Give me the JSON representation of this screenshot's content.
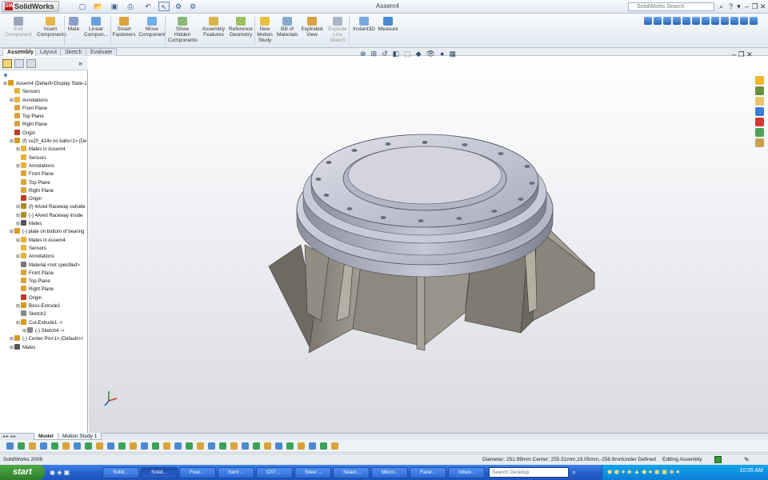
{
  "app": {
    "brand": "SolidWorks",
    "document_title": "Assem4",
    "search_placeholder": "SolidWorks Search"
  },
  "ribbon": [
    {
      "label": "Edit Component",
      "icon": "edit-component-icon",
      "enabled": false
    },
    {
      "label": "Insert Components",
      "icon": "insert-components-icon",
      "enabled": true
    },
    {
      "label": "Mate",
      "icon": "mate-icon",
      "enabled": true
    },
    {
      "label": "Linear Compon...",
      "icon": "linear-pattern-icon",
      "enabled": true
    },
    {
      "label": "Smart Fasteners",
      "icon": "smart-fasteners-icon",
      "enabled": true
    },
    {
      "label": "Move Component",
      "icon": "move-component-icon",
      "enabled": true
    },
    {
      "label": "Show Hidden Components",
      "icon": "show-hidden-icon",
      "enabled": true
    },
    {
      "label": "Assembly Features",
      "icon": "assembly-features-icon",
      "enabled": true
    },
    {
      "label": "Reference Geometry",
      "icon": "reference-geometry-icon",
      "enabled": true
    },
    {
      "label": "New Motion Study",
      "icon": "motion-study-icon",
      "enabled": true
    },
    {
      "label": "Bill of Materials",
      "icon": "bom-icon",
      "enabled": true
    },
    {
      "label": "Exploded View",
      "icon": "exploded-view-icon",
      "enabled": true
    },
    {
      "label": "Explode Line Sketch",
      "icon": "explode-line-icon",
      "enabled": false
    },
    {
      "label": "Instant3D",
      "icon": "instant3d-icon",
      "enabled": true
    },
    {
      "label": "Measure",
      "icon": "measure-icon",
      "enabled": true
    }
  ],
  "command_tabs": [
    "Assembly",
    "Layout",
    "Sketch",
    "Evaluate"
  ],
  "active_tab": "Assembly",
  "tree": [
    {
      "label": "Assem4 (Default<Display State-1",
      "indent": 0,
      "icon": "assembly-icon",
      "color": "#d49b1e"
    },
    {
      "label": "Sensors",
      "indent": 1,
      "icon": "sensors-icon",
      "color": "#e3b33c"
    },
    {
      "label": "Annotations",
      "indent": 1,
      "icon": "annotations-icon",
      "color": "#e3b33c"
    },
    {
      "label": "Front Plane",
      "indent": 1,
      "icon": "plane-icon",
      "color": "#d9a43a"
    },
    {
      "label": "Top Plane",
      "indent": 1,
      "icon": "plane-icon",
      "color": "#d9a43a"
    },
    {
      "label": "Right Plane",
      "indent": 1,
      "icon": "plane-icon",
      "color": "#d9a43a"
    },
    {
      "label": "Origin",
      "indent": 1,
      "icon": "origin-icon",
      "color": "#c0392b"
    },
    {
      "label": "(f) sx20_414v no balls<1> (De",
      "indent": 1,
      "icon": "subassembly-icon",
      "color": "#d49b1e"
    },
    {
      "label": "Mates in Assem4",
      "indent": 2,
      "icon": "mates-icon",
      "color": "#e3b33c"
    },
    {
      "label": "Sensors",
      "indent": 2,
      "icon": "sensors-icon",
      "color": "#e3b33c"
    },
    {
      "label": "Annotations",
      "indent": 2,
      "icon": "annotations-icon",
      "color": "#e3b33c"
    },
    {
      "label": "Front Plane",
      "indent": 2,
      "icon": "plane-icon",
      "color": "#d9a43a"
    },
    {
      "label": "Top Plane",
      "indent": 2,
      "icon": "plane-icon",
      "color": "#d9a43a"
    },
    {
      "label": "Right Plane",
      "indent": 2,
      "icon": "plane-icon",
      "color": "#d9a43a"
    },
    {
      "label": "Origin",
      "indent": 2,
      "icon": "origin-icon",
      "color": "#c0392b"
    },
    {
      "label": "(f) 4Ared Raceway outside",
      "indent": 2,
      "icon": "part-icon",
      "color": "#b08a2a"
    },
    {
      "label": "(-) 4Ared Raceway inside",
      "indent": 2,
      "icon": "part-icon",
      "color": "#b08a2a"
    },
    {
      "label": "Mates",
      "indent": 2,
      "icon": "mates-icon",
      "color": "#555"
    },
    {
      "label": "(-) plate on bottom of bearing",
      "indent": 1,
      "icon": "part-icon",
      "color": "#d49b1e"
    },
    {
      "label": "Mates in Assem4",
      "indent": 2,
      "icon": "mates-icon",
      "color": "#e3b33c"
    },
    {
      "label": "Sensors",
      "indent": 2,
      "icon": "sensors-icon",
      "color": "#e3b33c"
    },
    {
      "label": "Annotations",
      "indent": 2,
      "icon": "annotations-icon",
      "color": "#e3b33c"
    },
    {
      "label": "Material <not specified>",
      "indent": 2,
      "icon": "material-icon",
      "color": "#777"
    },
    {
      "label": "Front Plane",
      "indent": 2,
      "icon": "plane-icon",
      "color": "#d9a43a"
    },
    {
      "label": "Top Plane",
      "indent": 2,
      "icon": "plane-icon",
      "color": "#d9a43a"
    },
    {
      "label": "Right Plane",
      "indent": 2,
      "icon": "plane-icon",
      "color": "#d9a43a"
    },
    {
      "label": "Origin",
      "indent": 2,
      "icon": "origin-icon",
      "color": "#c0392b"
    },
    {
      "label": "Boss-Extrude1",
      "indent": 2,
      "icon": "extrude-icon",
      "color": "#d49b1e"
    },
    {
      "label": "Sketch2",
      "indent": 2,
      "icon": "sketch-icon",
      "color": "#888"
    },
    {
      "label": "Cut-Extrude1 ->",
      "indent": 2,
      "icon": "cut-extrude-icon",
      "color": "#d49b1e"
    },
    {
      "label": "(-) Sketch4 ->",
      "indent": 3,
      "icon": "sketch-icon",
      "color": "#888"
    },
    {
      "label": "(-) Center Pin<1> (Default<<",
      "indent": 1,
      "icon": "part-icon",
      "color": "#d49b1e"
    },
    {
      "label": "Mates",
      "indent": 1,
      "icon": "mates-icon",
      "color": "#555"
    }
  ],
  "motion_tabs": [
    "Model",
    "Motion Study 1"
  ],
  "status": {
    "version": "SolidWorks 2008",
    "measure": "Diameter: 251.99mm  Center: 255.51mm,19.05mm,-258.9mm",
    "definition": "Under Defined",
    "mode": "Editing Assembly"
  },
  "taskbar": {
    "start": "start",
    "buttons": [
      "Solid...",
      "Solid...",
      "Four...",
      "Sent ...",
      "Ch7...",
      "Steel ...",
      "Searc...",
      "Micro...",
      "Face...",
      "Inbox..."
    ],
    "active_index": 1,
    "search_placeholder": "Search Desktop",
    "clock": "10:05 AM"
  },
  "colors": {
    "accent": "#2560cd",
    "brand": "#c0141b",
    "tree_selected": "#cfe3fb"
  }
}
